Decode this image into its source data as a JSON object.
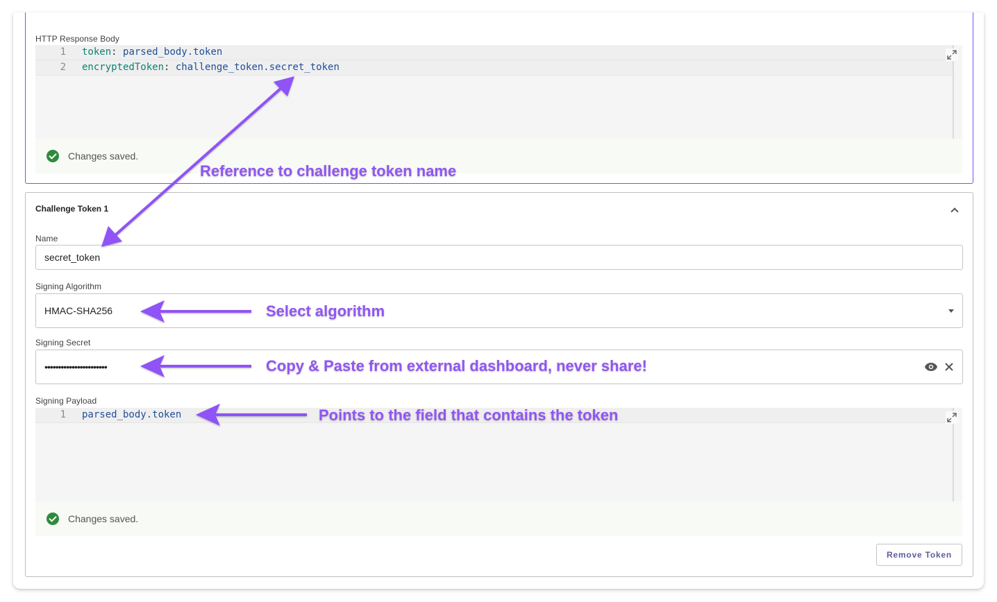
{
  "response_body": {
    "label": "HTTP Response Body",
    "lines": [
      {
        "num": "1",
        "key": "token",
        "value": "parsed_body.token"
      },
      {
        "num": "2",
        "key": "encryptedToken",
        "value": "challenge_token.secret_token"
      }
    ],
    "saved_text": "Changes saved."
  },
  "challenge_token": {
    "title": "Challenge Token 1",
    "name_label": "Name",
    "name_value": "secret_token",
    "algorithm_label": "Signing Algorithm",
    "algorithm_value": "HMAC-SHA256",
    "secret_label": "Signing Secret",
    "secret_value": "•••••••••••••••••••••••",
    "payload_label": "Signing Payload",
    "payload_lines": [
      {
        "num": "1",
        "value": "parsed_body.token"
      }
    ],
    "saved_text": "Changes saved.",
    "remove_label": "Remove Token"
  },
  "annotations": {
    "reference": "Reference to challenge token name",
    "algorithm": "Select algorithm",
    "secret": "Copy & Paste from external dashboard, never share!",
    "payload": "Points to the field that contains the token"
  },
  "colors": {
    "accent": "#7c4dff",
    "annotation": "#9155f5",
    "success": "#2e8b3e"
  },
  "icons": [
    "expand-icon",
    "check-circle-icon",
    "chevron-up-icon",
    "dropdown-arrow-icon",
    "eye-icon",
    "clear-icon"
  ]
}
